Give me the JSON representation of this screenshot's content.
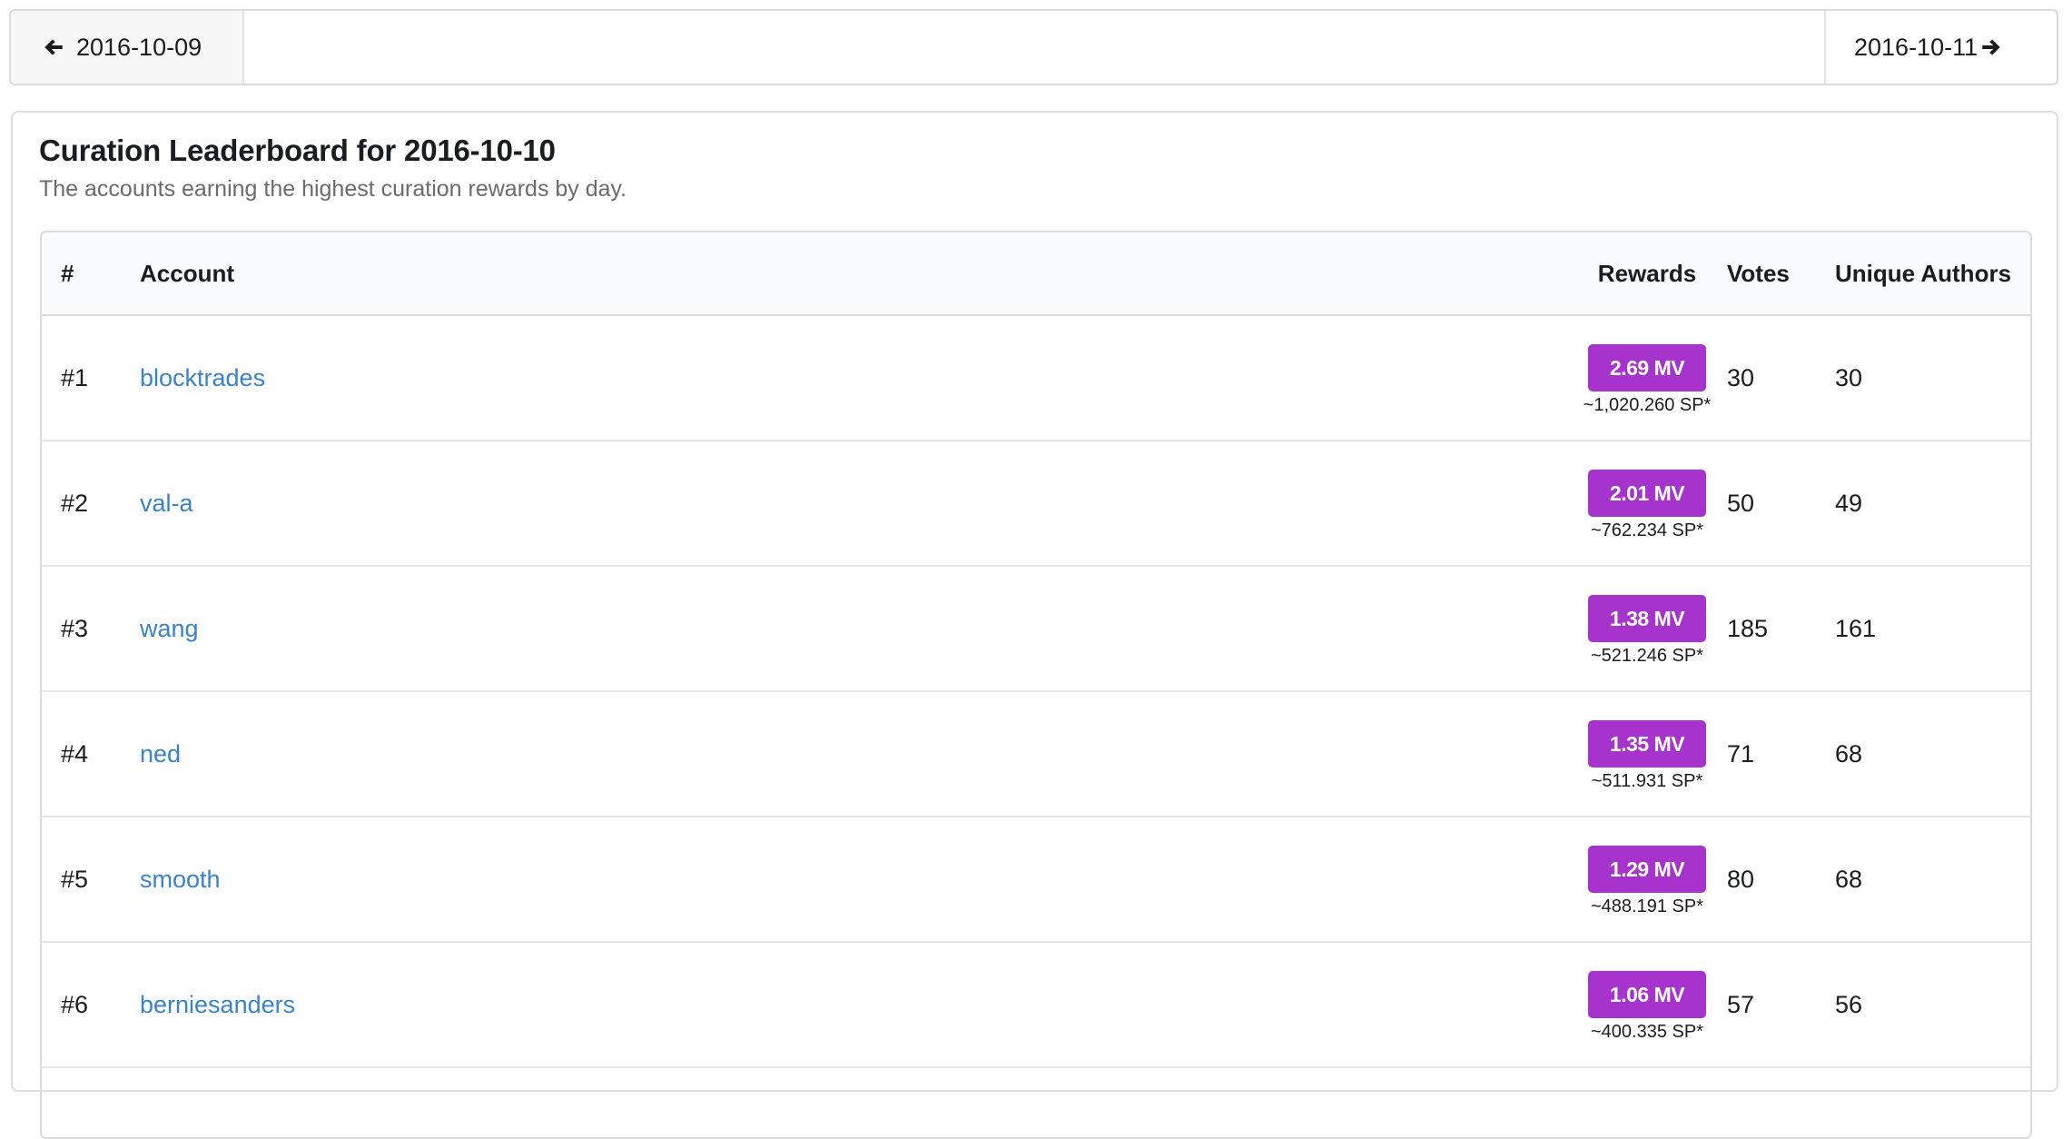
{
  "nav": {
    "prev_label": "2016-10-09",
    "next_label": "2016-10-11",
    "prev_icon": "arrow-left-icon",
    "next_icon": "arrow-right-icon"
  },
  "header": {
    "title": "Curation Leaderboard for 2016-10-10",
    "subtitle": "The accounts earning the highest curation rewards by day."
  },
  "table": {
    "columns": {
      "rank": "#",
      "account": "Account",
      "rewards": "Rewards",
      "votes": "Votes",
      "authors": "Unique Authors"
    },
    "rows": [
      {
        "rank": "#1",
        "account": "blocktrades",
        "reward": "2.69 MV",
        "sp": "~1,020.260 SP*",
        "votes": "30",
        "authors": "30"
      },
      {
        "rank": "#2",
        "account": "val-a",
        "reward": "2.01 MV",
        "sp": "~762.234 SP*",
        "votes": "50",
        "authors": "49"
      },
      {
        "rank": "#3",
        "account": "wang",
        "reward": "1.38 MV",
        "sp": "~521.246 SP*",
        "votes": "185",
        "authors": "161"
      },
      {
        "rank": "#4",
        "account": "ned",
        "reward": "1.35 MV",
        "sp": "~511.931 SP*",
        "votes": "71",
        "authors": "68"
      },
      {
        "rank": "#5",
        "account": "smooth",
        "reward": "1.29 MV",
        "sp": "~488.191 SP*",
        "votes": "80",
        "authors": "68"
      },
      {
        "rank": "#6",
        "account": "berniesanders",
        "reward": "1.06 MV",
        "sp": "~400.335 SP*",
        "votes": "57",
        "authors": "56"
      }
    ]
  },
  "colors": {
    "badge": "#a633cc",
    "link": "#3b82c9",
    "header_bg": "#f9fafb",
    "prev_button_bg": "#f7f7f7"
  }
}
